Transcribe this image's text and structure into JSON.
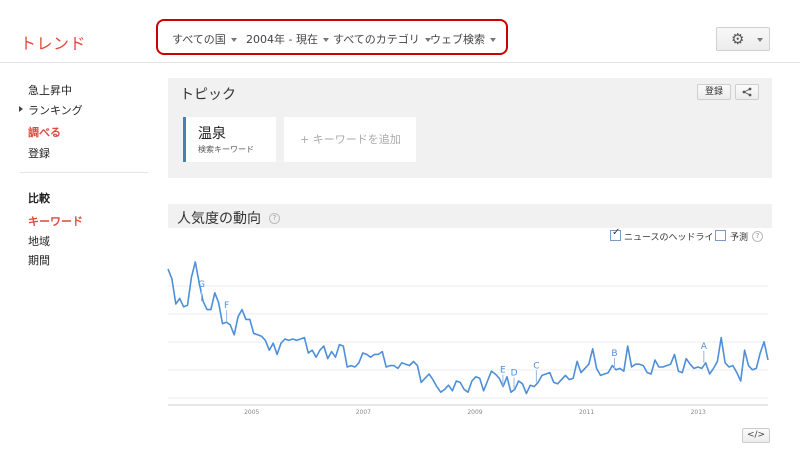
{
  "app": {
    "logo": "トレンド"
  },
  "filters": [
    {
      "label": "すべての国"
    },
    {
      "label": "2004年 - 現在"
    },
    {
      "label": "すべてのカテゴリ"
    },
    {
      "label": "ウェブ検索"
    }
  ],
  "settings": {
    "icon": "gear-icon"
  },
  "sidebar": {
    "items": [
      {
        "label": "急上昇中"
      },
      {
        "label": "ランキング"
      },
      {
        "label": "調べる"
      },
      {
        "label": "登録"
      }
    ],
    "compare_heading": "比較",
    "compare_items": [
      {
        "label": "キーワード"
      },
      {
        "label": "地域"
      },
      {
        "label": "期間"
      }
    ]
  },
  "topics": {
    "title": "トピック",
    "subscribe_label": "登録",
    "share_icon": "share-icon",
    "keyword": {
      "name": "温泉",
      "type": "検索キーワード"
    },
    "add_placeholder": "+ キーワードを追加"
  },
  "trend": {
    "title": "人気度の動向",
    "help": "?",
    "headlines_label": "ニュースのヘッドライン",
    "headlines_checked": true,
    "forecast_label": "予測",
    "forecast_checked": false,
    "embed_label": "</>"
  },
  "chart_data": {
    "type": "line",
    "series_color": "#4d8fd8",
    "x_ticks": [
      "2005",
      "2007",
      "2009",
      "2011",
      "2013"
    ],
    "ylim": [
      0,
      100
    ],
    "grid": true,
    "x_start": 2004.0,
    "x_end": 2014.75,
    "values": [
      95,
      88,
      70,
      74,
      68,
      69,
      89,
      100,
      85,
      72,
      66,
      66,
      78,
      71,
      56,
      57,
      55,
      48,
      61,
      66,
      59,
      59,
      49,
      48,
      47,
      44,
      37,
      42,
      34,
      42,
      45,
      44,
      45,
      44,
      45,
      46,
      35,
      37,
      32,
      37,
      40,
      31,
      36,
      32,
      41,
      40,
      25,
      26,
      25,
      28,
      35,
      34,
      32,
      34,
      34,
      36,
      25,
      26,
      26,
      24,
      28,
      27,
      26,
      29,
      26,
      14,
      17,
      20,
      16,
      11,
      7,
      9,
      12,
      8,
      15,
      14,
      9,
      7,
      15,
      18,
      17,
      8,
      15,
      22,
      20,
      17,
      11,
      18,
      7,
      9,
      15,
      13,
      6,
      12,
      11,
      14,
      19,
      20,
      21,
      14,
      13,
      16,
      19,
      16,
      17,
      29,
      21,
      24,
      27,
      38,
      24,
      19,
      20,
      21,
      26,
      23,
      24,
      22,
      40,
      25,
      27,
      27,
      26,
      21,
      20,
      30,
      25,
      25,
      26,
      27,
      34,
      22,
      21,
      31,
      27,
      24,
      25,
      24,
      28,
      20,
      24,
      29,
      46,
      28,
      25,
      26,
      21,
      15,
      37,
      26,
      23,
      24,
      35,
      43,
      30
    ],
    "annotations": [
      {
        "letter": "G",
        "x": 2004.6
      },
      {
        "letter": "F",
        "x": 2005.05
      },
      {
        "letter": "E",
        "x": 2010.0
      },
      {
        "letter": "D",
        "x": 2010.2
      },
      {
        "letter": "C",
        "x": 2010.6
      },
      {
        "letter": "B",
        "x": 2012.0
      },
      {
        "letter": "A",
        "x": 2013.6
      }
    ]
  }
}
